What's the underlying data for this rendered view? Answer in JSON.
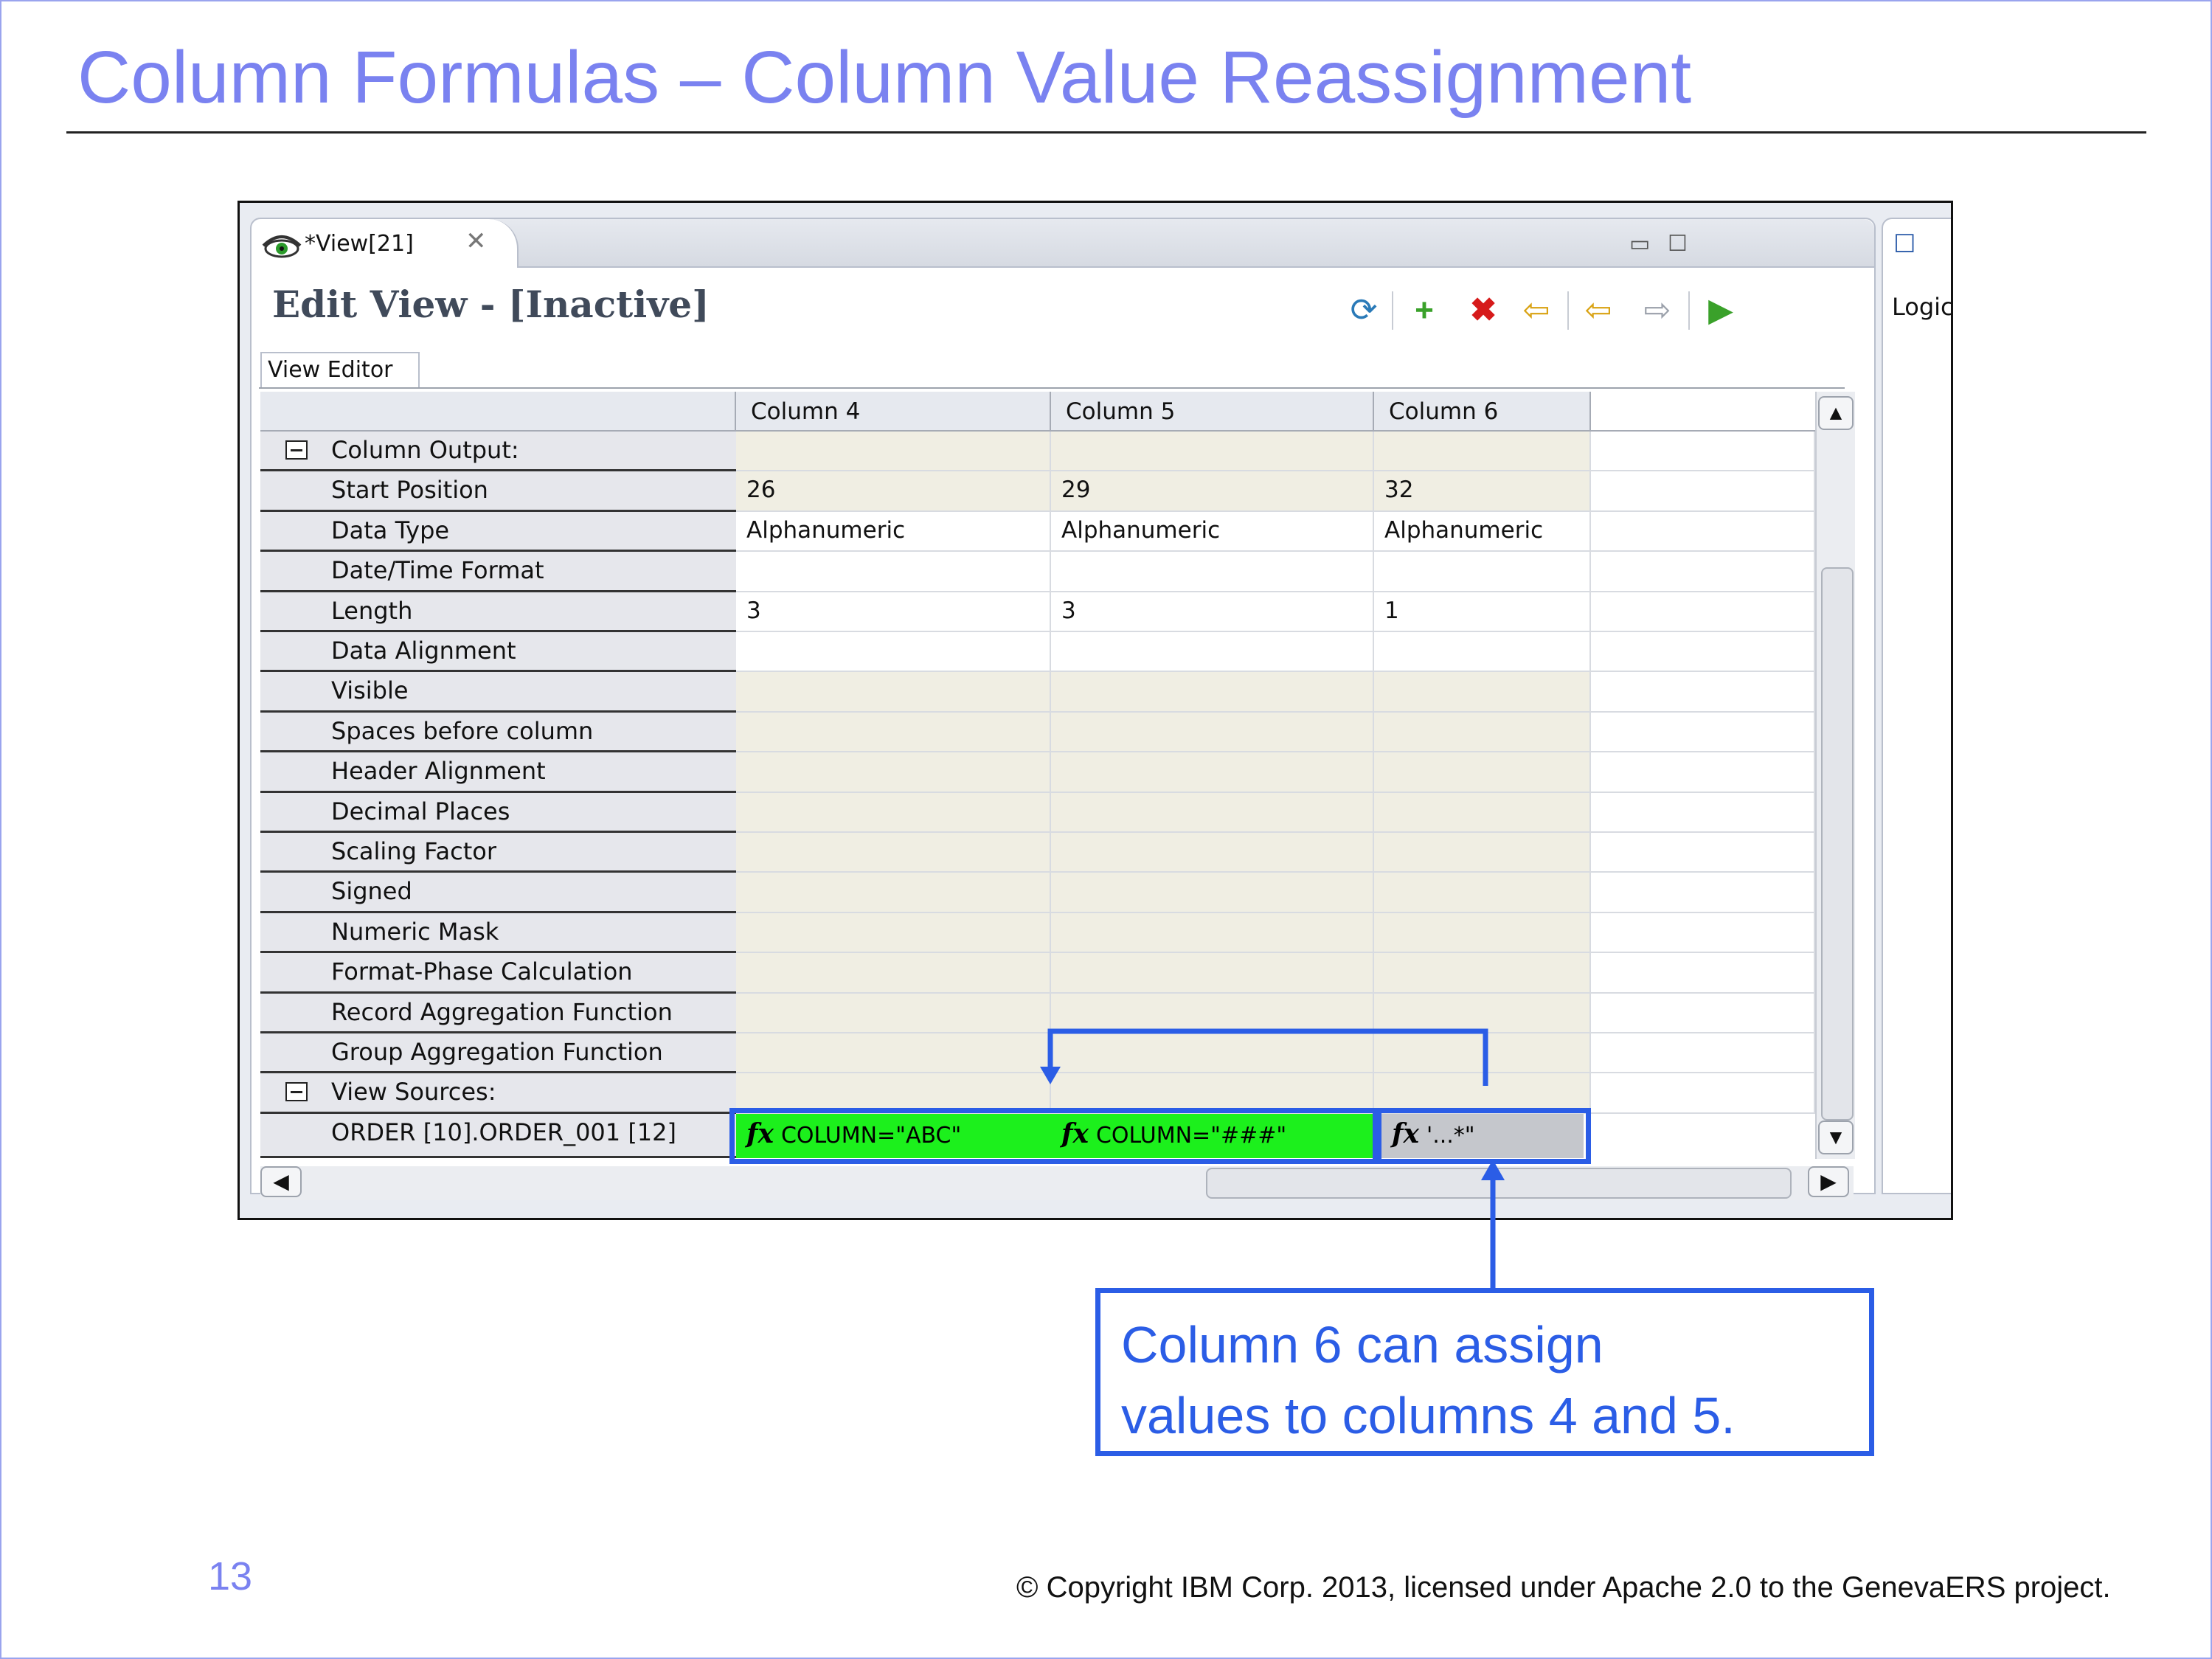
{
  "slide": {
    "title": "Column Formulas – Column Value Reassignment",
    "page_number": "13",
    "copyright": "© Copyright IBM Corp. 2013, licensed under Apache 2.0 to the GenevaERS project.",
    "callout_line1": "Column 6 can assign",
    "callout_line2": "values to columns 4 and 5."
  },
  "window": {
    "tab_label": "*View[21]",
    "editor_title": "Edit View - [Inactive]",
    "subtab_label": "View Editor",
    "side_panel_label": "Logic"
  },
  "toolbar": {
    "icons": [
      "refresh-icon",
      "add-icon",
      "delete-icon",
      "insert-before-icon",
      "move-left-icon",
      "move-right-icon",
      "run-icon"
    ]
  },
  "grid": {
    "columns": [
      "Column 4",
      "Column 5",
      "Column 6"
    ],
    "rows": [
      {
        "label": "Column Output:",
        "section": true,
        "values": [
          "",
          "",
          ""
        ]
      },
      {
        "label": "Start Position",
        "values": [
          "26",
          "29",
          "32"
        ]
      },
      {
        "label": "Data Type",
        "values": [
          "Alphanumeric",
          "Alphanumeric",
          "Alphanumeric"
        ]
      },
      {
        "label": "Date/Time Format",
        "values": [
          "",
          "",
          ""
        ]
      },
      {
        "label": "Length",
        "values": [
          "3",
          "3",
          "1"
        ]
      },
      {
        "label": "Data Alignment",
        "values": [
          "",
          "",
          ""
        ]
      },
      {
        "label": "Visible",
        "values": [
          "",
          "",
          ""
        ]
      },
      {
        "label": "Spaces before column",
        "values": [
          "",
          "",
          ""
        ]
      },
      {
        "label": "Header Alignment",
        "values": [
          "",
          "",
          ""
        ]
      },
      {
        "label": "Decimal Places",
        "values": [
          "",
          "",
          ""
        ]
      },
      {
        "label": "Scaling Factor",
        "values": [
          "",
          "",
          ""
        ]
      },
      {
        "label": "Signed",
        "values": [
          "",
          "",
          ""
        ]
      },
      {
        "label": "Numeric Mask",
        "values": [
          "",
          "",
          ""
        ]
      },
      {
        "label": "Format-Phase Calculation",
        "values": [
          "",
          "",
          ""
        ]
      },
      {
        "label": "Record Aggregation Function",
        "values": [
          "",
          "",
          ""
        ]
      },
      {
        "label": "Group Aggregation Function",
        "values": [
          "",
          "",
          ""
        ]
      },
      {
        "label": "View Sources:",
        "section": true,
        "values": [
          "",
          "",
          ""
        ]
      }
    ],
    "source_row": {
      "label": "ORDER [10].ORDER_001 [12]",
      "formulas": [
        "COLUMN=\"ABC\"",
        "COLUMN=\"###\"",
        "'...*\""
      ]
    }
  },
  "colors": {
    "title": "#7a82f0",
    "highlight": "#2b5de6",
    "formula_green": "#1cf01c",
    "cell_beige": "#f0eee3"
  }
}
